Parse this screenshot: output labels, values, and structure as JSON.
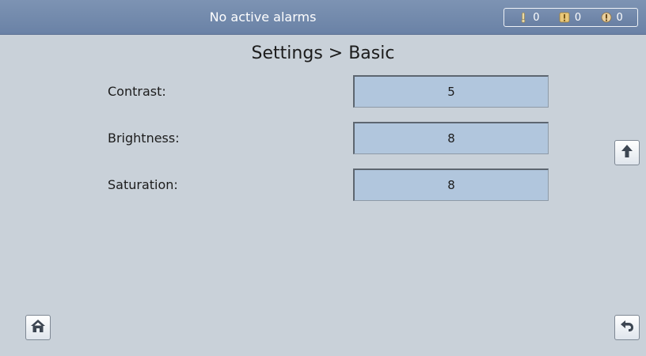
{
  "header": {
    "alarm_status": "No active alarms",
    "counters": [
      {
        "icon": "minor-alarm-icon",
        "value": "0"
      },
      {
        "icon": "major-alarm-icon",
        "value": "0"
      },
      {
        "icon": "critical-alarm-icon",
        "value": "0"
      }
    ]
  },
  "page": {
    "title": "Settings > Basic"
  },
  "settings": [
    {
      "label": "Contrast:",
      "value": "5"
    },
    {
      "label": "Brightness:",
      "value": "8"
    },
    {
      "label": "Saturation:",
      "value": "8"
    }
  ],
  "nav": {
    "up_icon": "arrow-up-icon",
    "home_icon": "home-icon",
    "back_icon": "back-arrow-icon"
  },
  "colors": {
    "header_bg": "#6f86a9",
    "background": "#c9d1d9",
    "field_bg": "#b1c6dd"
  }
}
